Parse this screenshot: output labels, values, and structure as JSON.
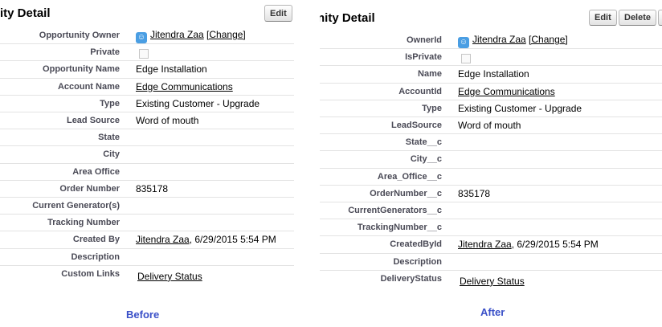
{
  "before": {
    "section_title": "ity Detail",
    "edit_label": "Edit",
    "owner_label": "Opportunity Owner",
    "owner_name": "Jitendra Zaa",
    "owner_change": "[Change]",
    "private_label": "Private",
    "rows": [
      {
        "label": "Opportunity Name",
        "value": "Edge Installation",
        "link": false
      },
      {
        "label": "Account Name",
        "value": "Edge Communications",
        "link": true
      },
      {
        "label": "Type",
        "value": "Existing Customer - Upgrade",
        "link": false
      },
      {
        "label": "Lead Source",
        "value": "Word of mouth",
        "link": false
      },
      {
        "label": "State",
        "value": "",
        "link": false
      },
      {
        "label": "City",
        "value": "",
        "link": false
      },
      {
        "label": "Area Office",
        "value": "",
        "link": false
      },
      {
        "label": "Order Number",
        "value": "835178",
        "link": false
      },
      {
        "label": "Current Generator(s)",
        "value": "",
        "link": false
      },
      {
        "label": "Tracking Number",
        "value": "",
        "link": false
      }
    ],
    "created_label": "Created By",
    "created_user": "Jitendra Zaa",
    "created_date": ", 6/29/2015 5:54 PM",
    "description_label": "Description",
    "custom_links_label": "Custom Links",
    "custom_link": "Delivery Status",
    "caption": "Before"
  },
  "after": {
    "section_title": "nity Detail",
    "edit_label": "Edit",
    "delete_label": "Delete",
    "owner_label": "OwnerId",
    "owner_name": "Jitendra Zaa",
    "owner_change": "[Change]",
    "private_label": "IsPrivate",
    "rows": [
      {
        "label": "Name",
        "value": "Edge Installation",
        "link": false
      },
      {
        "label": "AccountId",
        "value": "Edge Communications",
        "link": true
      },
      {
        "label": "Type",
        "value": "Existing Customer - Upgrade",
        "link": false
      },
      {
        "label": "LeadSource",
        "value": "Word of mouth",
        "link": false
      },
      {
        "label": "State__c",
        "value": "",
        "link": false
      },
      {
        "label": "City__c",
        "value": "",
        "link": false
      },
      {
        "label": "Area_Office__c",
        "value": "",
        "link": false
      },
      {
        "label": "OrderNumber__c",
        "value": "835178",
        "link": false
      },
      {
        "label": "CurrentGenerators__c",
        "value": "",
        "link": false
      },
      {
        "label": "TrackingNumber__c",
        "value": "",
        "link": false
      }
    ],
    "created_label": "CreatedById",
    "created_user": "Jitendra Zaa",
    "created_date": ", 6/29/2015 5:54 PM",
    "description_label": "Description",
    "custom_links_label": "DeliveryStatus",
    "custom_link": "Delivery Status",
    "caption": "After"
  }
}
